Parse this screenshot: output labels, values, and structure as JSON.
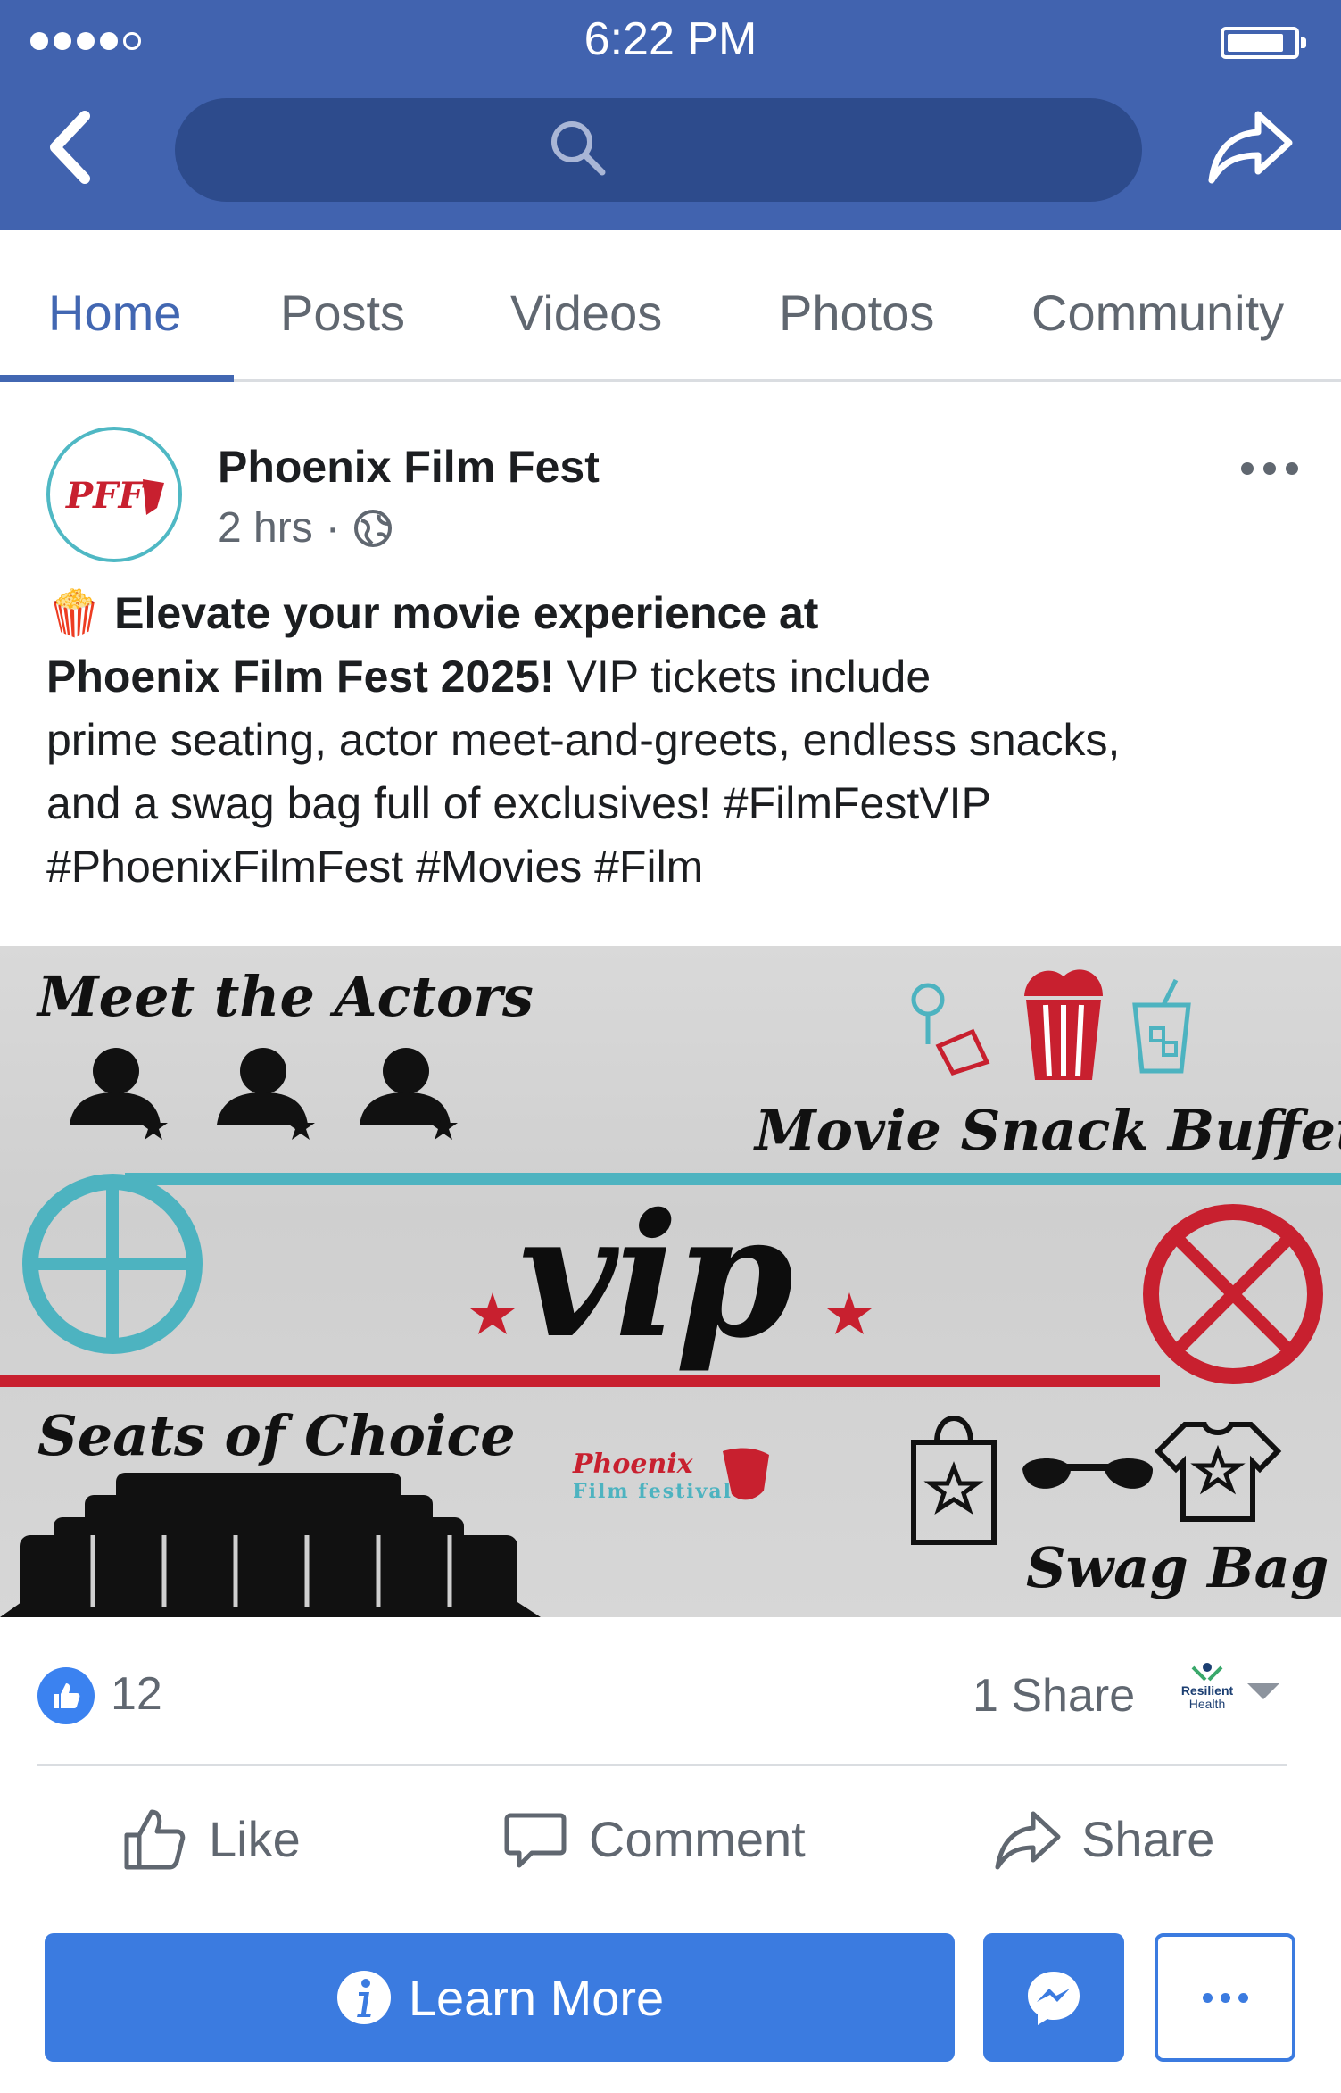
{
  "status_bar": {
    "time": "6:22 PM"
  },
  "tabs": [
    {
      "label": "Home",
      "active": true
    },
    {
      "label": "Posts"
    },
    {
      "label": "Videos"
    },
    {
      "label": "Photos"
    },
    {
      "label": "Community"
    }
  ],
  "post": {
    "page_name": "Phoenix Film Fest",
    "avatar_text": "PFF",
    "time": "2 hrs",
    "separator": "·",
    "emoji": "🍿",
    "bold_1": "Elevate your movie experience at",
    "bold_2": "Phoenix Film Fest 2025!",
    "text_2": " VIP tickets include",
    "text_3": "prime seating, actor meet-and-greets, endless snacks,",
    "text_4": "and a swag bag full of exclusives! #FilmFestVIP",
    "text_5": "#PhoenixFilmFest #Movies #Film"
  },
  "banner": {
    "meet_actors": "Meet the Actors",
    "snack_buffet": "Movie Snack Buffet",
    "vip": "vip",
    "seats": "Seats of Choice",
    "swag": "Swag Bag",
    "logo_1": "Phoenix",
    "logo_2": "Film festival",
    "teal": "#4db3c0",
    "red": "#c8202f"
  },
  "stats": {
    "likes": "12",
    "shares": "1 Share",
    "page_logo_1": "Resilient",
    "page_logo_2": "Health"
  },
  "actions": {
    "like": "Like",
    "comment": "Comment",
    "share": "Share"
  },
  "cta": {
    "learn_more": "Learn More"
  },
  "colors": {
    "header_blue": "#4163af",
    "fb_blue": "#4267b2",
    "button_blue": "#3b7be0"
  }
}
